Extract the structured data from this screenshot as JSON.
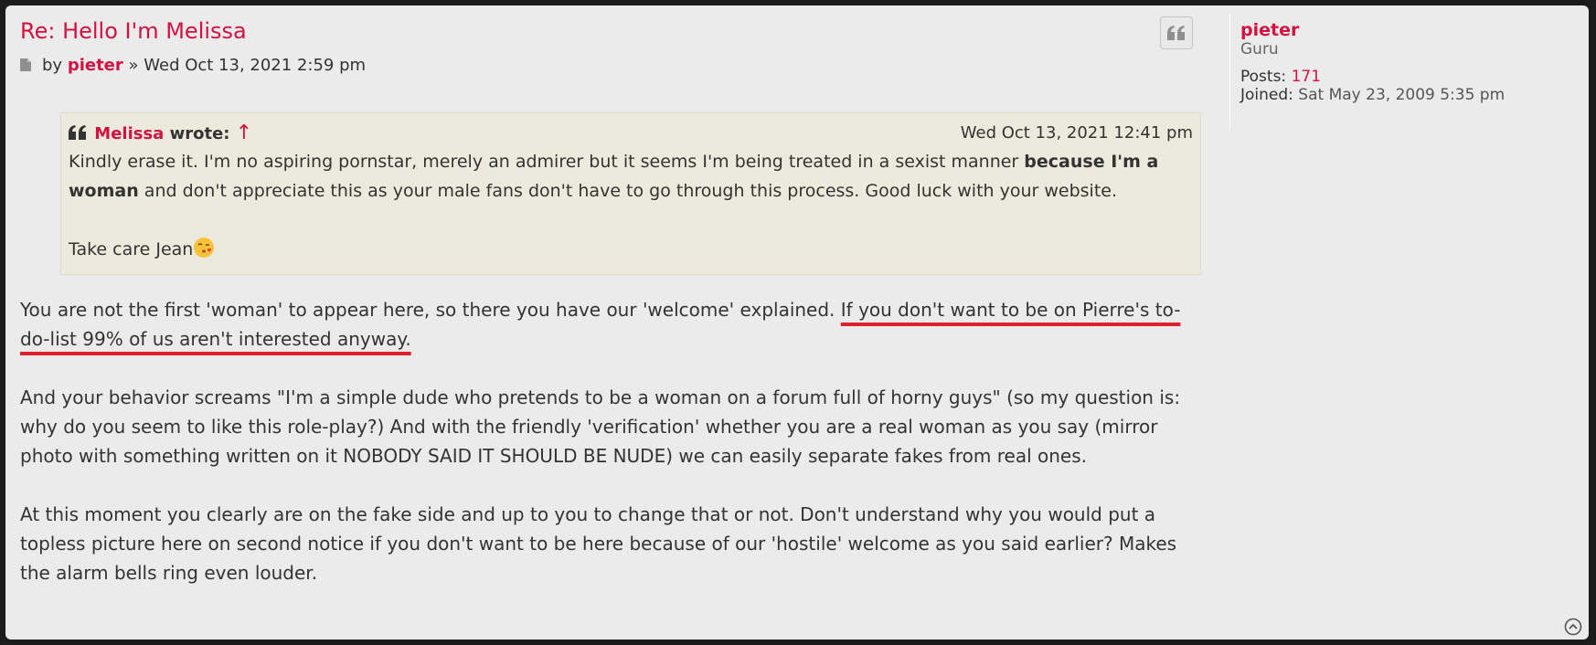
{
  "post": {
    "title": "Re: Hello I'm Melissa",
    "by_label": "by",
    "author": "pieter",
    "separator": "»",
    "date": "Wed Oct 13, 2021 2:59 pm"
  },
  "sidebar": {
    "username": "pieter",
    "rank": "Guru",
    "posts_label": "Posts:",
    "posts_value": "171",
    "joined_label": "Joined:",
    "joined_value": "Sat May 23, 2009 5:35 pm"
  },
  "quote": {
    "author": "Melissa",
    "wrote_label": "wrote:",
    "arrow": "↑",
    "date": "Wed Oct 13, 2021 12:41 pm",
    "text_part1": "Kindly erase it. I'm no aspiring pornstar, merely an admirer but it seems I'm being treated in a sexist manner ",
    "text_bold": "because I'm a woman",
    "text_part2": " and don't appreciate this as your male fans don't have to go through this process. Good luck with your website.",
    "signoff": "Take care Jean",
    "emoji_icon": "kiss-emoji-icon"
  },
  "body": {
    "p1_plain": "You are not the first 'woman' to appear here, so there you have our 'welcome' explained. ",
    "p1_highlight": "If you don't want to be on Pierre's to-do-list 99% of us aren't interested anyway.",
    "p2": "And your behavior screams \"I'm a simple dude who pretends to be a woman on a forum full of horny guys\" (so my question is: why do you seem to like this role-play?) And with the friendly 'verification' whether you are a real woman as you say (mirror photo with something written on it NOBODY SAID IT SHOULD BE NUDE) we can easily separate fakes from real ones.",
    "p3": "At this moment you clearly are on the fake side and up to you to change that or not. Don't understand why you would put a topless picture here on second notice if you don't want to be here because of our 'hostile' welcome as you said earlier? Makes the alarm bells ring even louder."
  },
  "colors": {
    "accent": "#d31141",
    "underline": "#e0202e",
    "post_bg": "#ebebeb",
    "quote_bg": "#ebeadd"
  }
}
